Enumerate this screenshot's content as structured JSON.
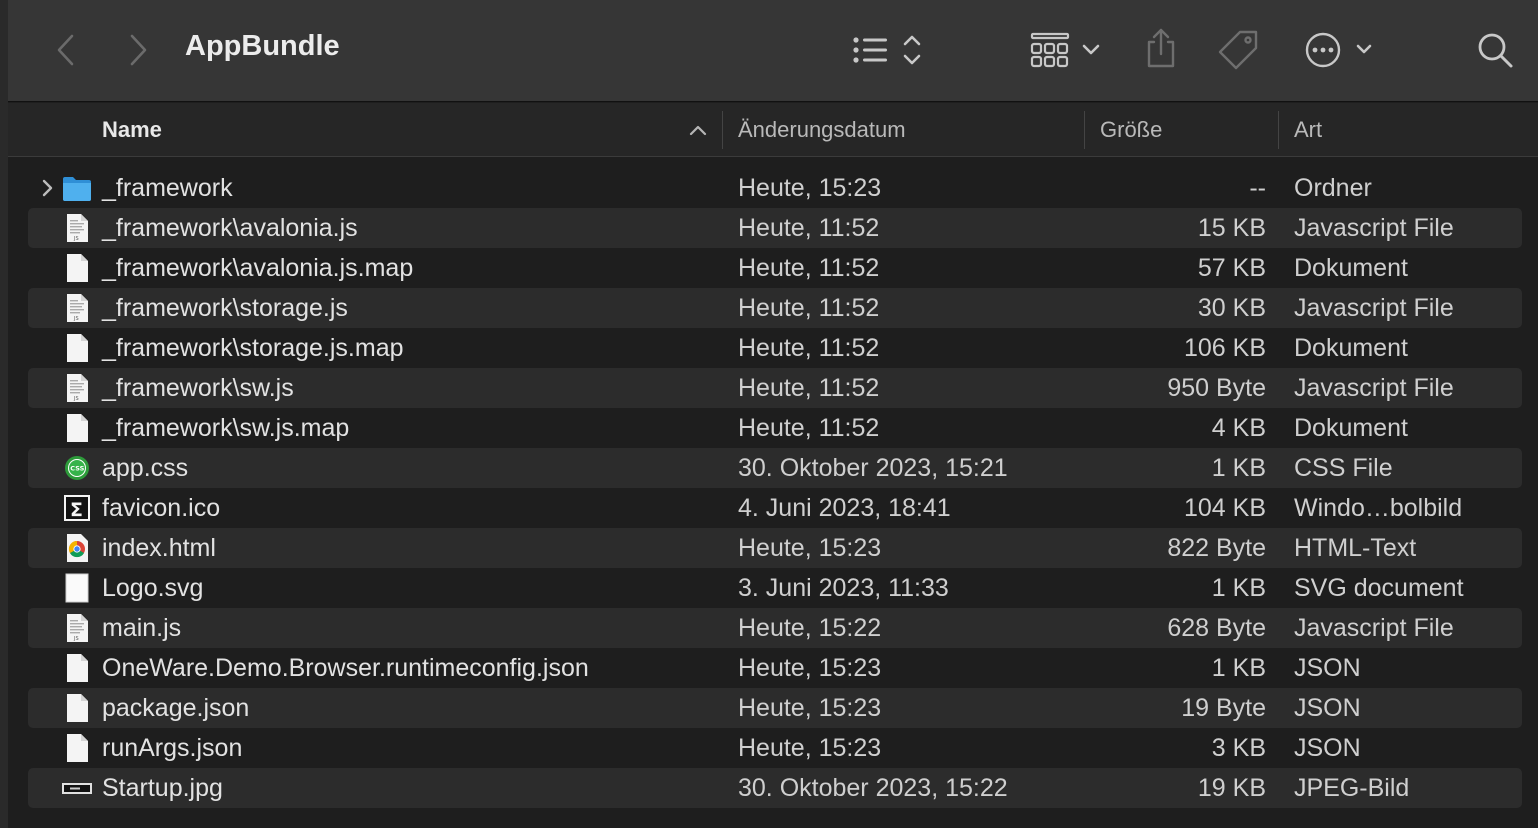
{
  "window": {
    "title": "AppBundle"
  },
  "toolbar": {
    "back_icon": "chevron-left-icon",
    "forward_icon": "chevron-right-icon",
    "view_icon": "list-view-icon",
    "group_icon": "grid-group-icon",
    "share_icon": "share-icon",
    "tag_icon": "tag-icon",
    "more_icon": "ellipsis-circle-icon",
    "search_icon": "search-icon"
  },
  "columns": {
    "name": "Name",
    "date": "Änderungsdatum",
    "size": "Größe",
    "kind": "Art"
  },
  "files": [
    {
      "name": "_framework",
      "date": "Heute, 15:23",
      "size": "--",
      "kind": "Ordner",
      "icon": "folder-icon"
    },
    {
      "name": "_framework\\avalonia.js",
      "date": "Heute, 11:52",
      "size": "15 KB",
      "kind": "Javascript File",
      "icon": "js-file-icon"
    },
    {
      "name": "_framework\\avalonia.js.map",
      "date": "Heute, 11:52",
      "size": "57 KB",
      "kind": "Dokument",
      "icon": "document-icon"
    },
    {
      "name": "_framework\\storage.js",
      "date": "Heute, 11:52",
      "size": "30 KB",
      "kind": "Javascript File",
      "icon": "js-file-icon"
    },
    {
      "name": "_framework\\storage.js.map",
      "date": "Heute, 11:52",
      "size": "106 KB",
      "kind": "Dokument",
      "icon": "document-icon"
    },
    {
      "name": "_framework\\sw.js",
      "date": "Heute, 11:52",
      "size": "950 Byte",
      "kind": "Javascript File",
      "icon": "js-file-icon"
    },
    {
      "name": "_framework\\sw.js.map",
      "date": "Heute, 11:52",
      "size": "4 KB",
      "kind": "Dokument",
      "icon": "document-icon"
    },
    {
      "name": "app.css",
      "date": "30. Oktober 2023, 15:21",
      "size": "1 KB",
      "kind": "CSS File",
      "icon": "css-file-icon"
    },
    {
      "name": "favicon.ico",
      "date": "4. Juni 2023, 18:41",
      "size": "104 KB",
      "kind": "Windo…bolbild",
      "icon": "ico-file-icon"
    },
    {
      "name": "index.html",
      "date": "Heute, 15:23",
      "size": "822 Byte",
      "kind": "HTML-Text",
      "icon": "chrome-html-icon"
    },
    {
      "name": "Logo.svg",
      "date": "3. Juni 2023, 11:33",
      "size": "1 KB",
      "kind": "SVG document",
      "icon": "svg-file-icon"
    },
    {
      "name": "main.js",
      "date": "Heute, 15:22",
      "size": "628 Byte",
      "kind": "Javascript File",
      "icon": "js-file-icon"
    },
    {
      "name": "OneWare.Demo.Browser.runtimeconfig.json",
      "date": "Heute, 15:23",
      "size": "1 KB",
      "kind": "JSON",
      "icon": "json-file-icon"
    },
    {
      "name": "package.json",
      "date": "Heute, 15:23",
      "size": "19 Byte",
      "kind": "JSON",
      "icon": "json-file-icon"
    },
    {
      "name": "runArgs.json",
      "date": "Heute, 15:23",
      "size": "3 KB",
      "kind": "JSON",
      "icon": "json-file-icon"
    },
    {
      "name": "Startup.jpg",
      "date": "30. Oktober 2023, 15:22",
      "size": "19 KB",
      "kind": "JPEG-Bild",
      "icon": "image-file-icon"
    }
  ]
}
